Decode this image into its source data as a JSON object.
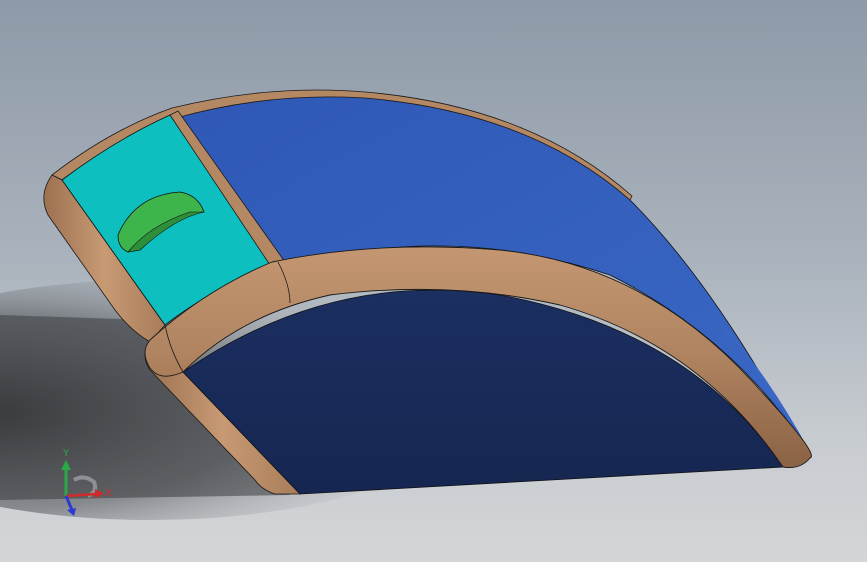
{
  "viewport": {
    "background_top": "#8e9aa8",
    "background_bottom": "#d3d5d7"
  },
  "model": {
    "top_face_color": "#3461bd",
    "front_face_color": "#182b58",
    "panel_color": "#0dbfbf",
    "edge_color": "#b48862",
    "bump_color": "#3db54a"
  },
  "triad": {
    "x_label": "X",
    "y_label": "Y",
    "x_color": "#d22a2a",
    "y_color": "#2aa84a",
    "z_color": "#2a3ad2"
  }
}
